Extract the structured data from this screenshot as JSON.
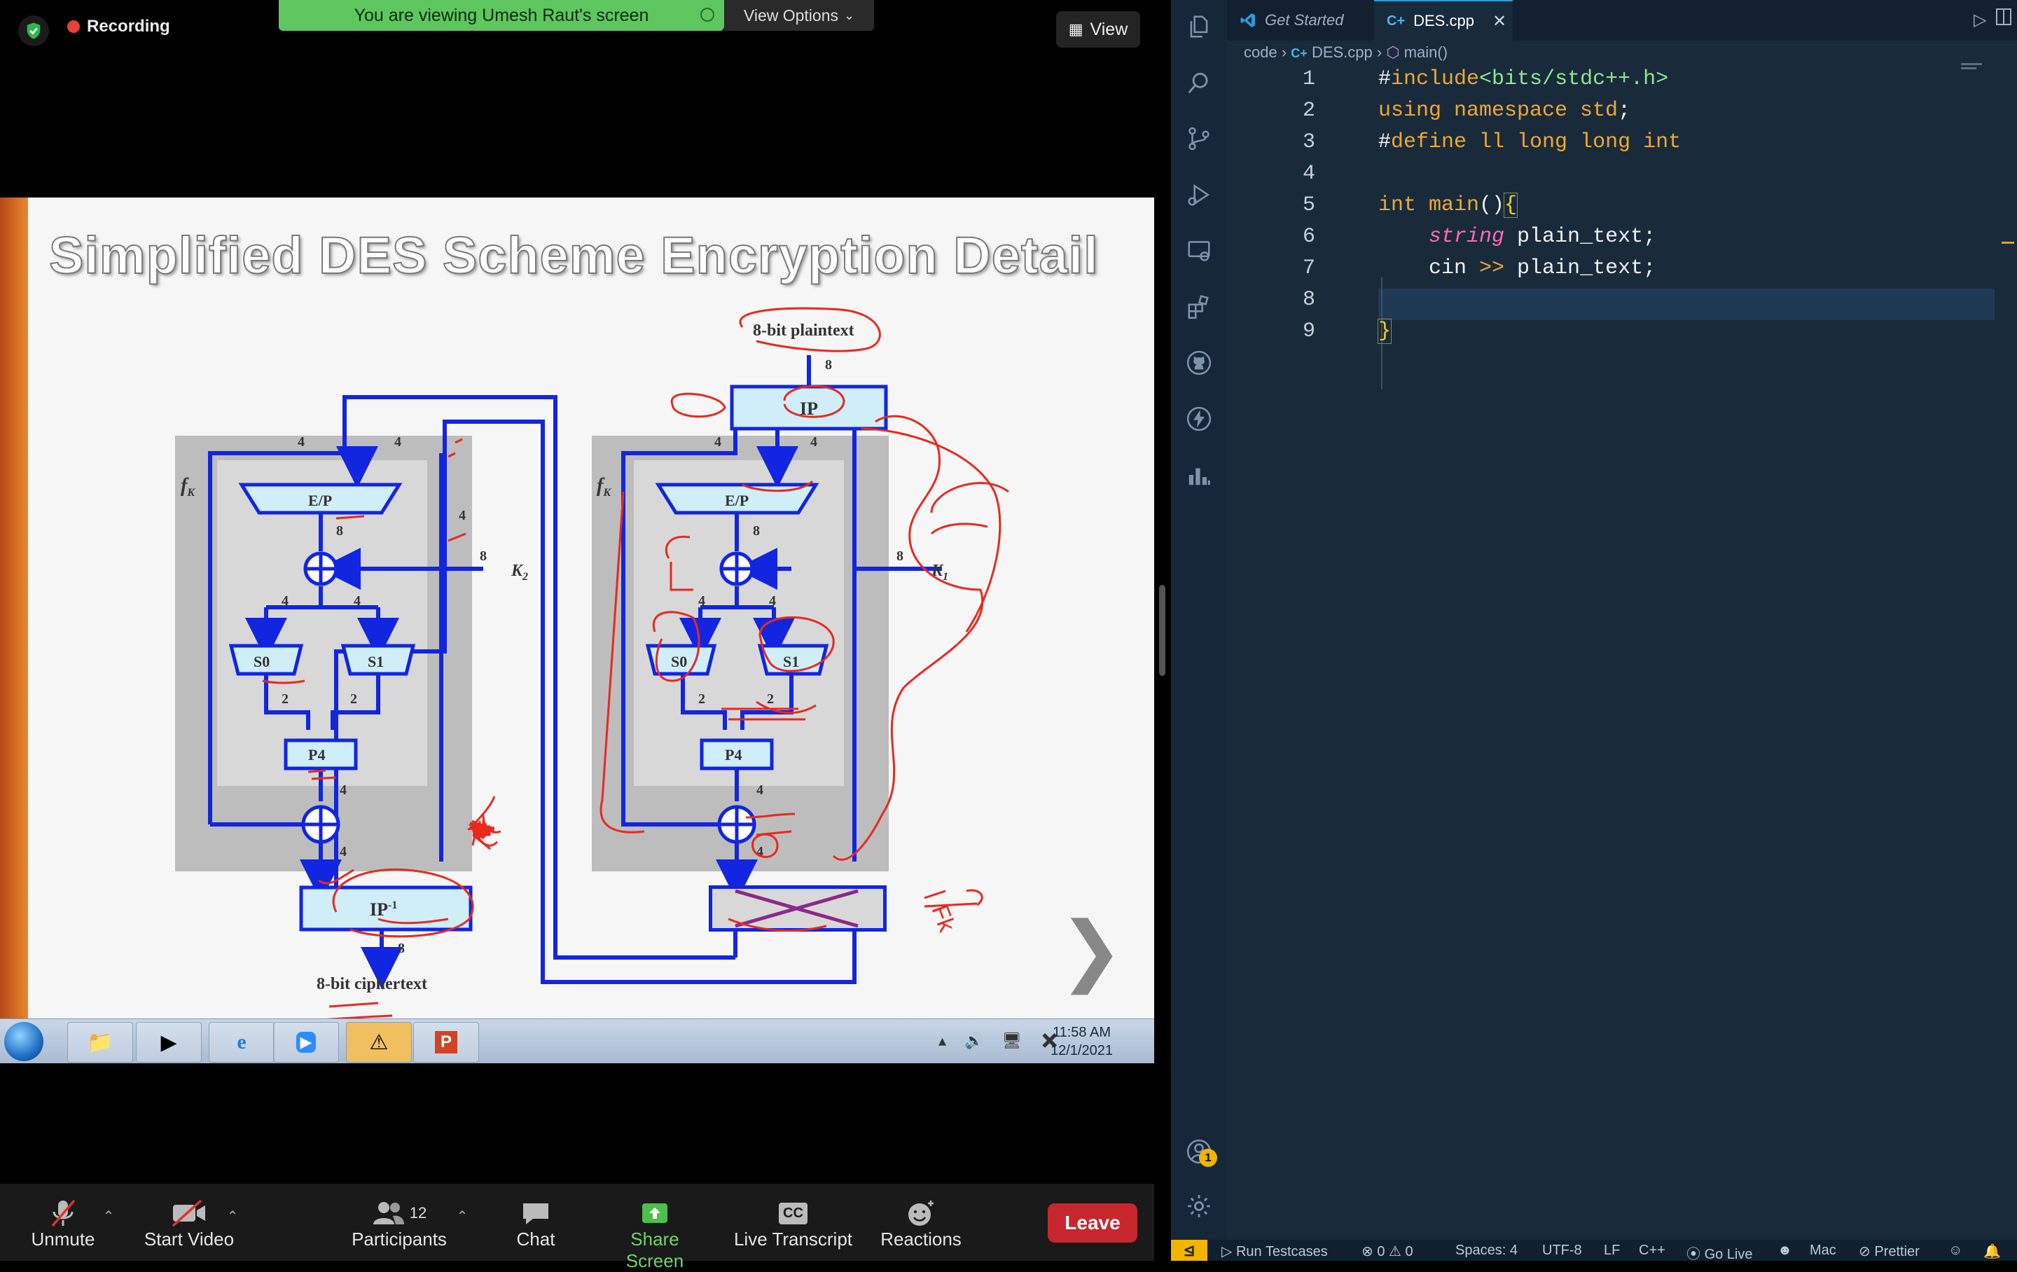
{
  "zoom": {
    "recording_label": "Recording",
    "banner_text": "You are viewing Umesh Raut's screen",
    "view_options_label": "View Options",
    "view_button_label": "View",
    "toolbar": {
      "unmute": "Unmute",
      "start_video": "Start Video",
      "participants": "Participants",
      "participants_count": "12",
      "chat": "Chat",
      "share_screen": "Share Screen",
      "live_transcript": "Live Transcript",
      "cc": "CC",
      "reactions": "Reactions",
      "leave": "Leave"
    }
  },
  "slide": {
    "title": "Simplified DES Scheme Encryption Detail",
    "plaintext_label": "8-bit plaintext",
    "ciphertext_label": "8-bit ciphertext",
    "ip": "IP",
    "ip_inverse": "IP",
    "ip_inverse_sup": "-1",
    "ep": "E/P",
    "s0": "S0",
    "s1": "S1",
    "p4": "P4",
    "fk": "f",
    "fk_sub": "K",
    "k1": "K",
    "k1_sub": "1",
    "k2": "K",
    "k2_sub": "2",
    "bits_8": "8",
    "bits_4": "4",
    "bits_2": "2",
    "annotation_fk": "Fk"
  },
  "taskbar": {
    "time": "11:58 AM",
    "date": "12/1/2021"
  },
  "vscode": {
    "tabs": [
      {
        "label": "Get Started"
      },
      {
        "label": "DES.cpp"
      }
    ],
    "breadcrumb": {
      "folder": "code",
      "file": "DES.cpp",
      "symbol": "main()"
    },
    "line_numbers": [
      "1",
      "2",
      "3",
      "4",
      "5",
      "6",
      "7",
      "8",
      "9"
    ],
    "status": {
      "run_testcases": "Run Testcases",
      "errors": "0",
      "warnings": "0",
      "spaces": "Spaces: 4",
      "encoding": "UTF-8",
      "eol": "LF",
      "language": "C++",
      "go_live": "Go Live",
      "os": "Mac",
      "prettier": "Prettier"
    },
    "notification_count": "1",
    "colors": {
      "keyword": "#f0a830",
      "type": "#ff6ab8",
      "string": "#8ce98c",
      "bracket": "#f5d400",
      "accent": "#2e9bd6"
    }
  }
}
